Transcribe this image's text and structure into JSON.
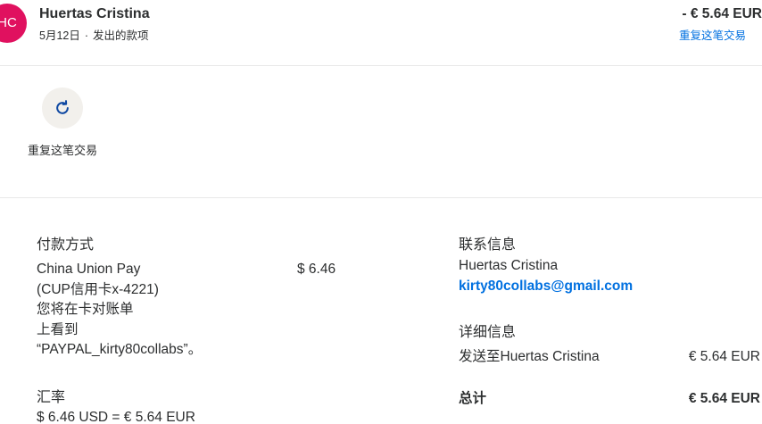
{
  "header": {
    "avatar_initials": "HC",
    "avatar_color": "#e0115f",
    "payee_name": "Huertas Cristina",
    "date": "5月12日",
    "separator": "·",
    "type": "发出的款项",
    "amount": "- € 5.64 EUR",
    "repeat_link": "重复这笔交易"
  },
  "actions": {
    "repeat_icon": "refresh-icon",
    "repeat_label": "重复这笔交易"
  },
  "payment": {
    "title": "付款方式",
    "method_line1": "China Union Pay",
    "method_line2": "(CUP信用卡x-4221)",
    "note_line1": "您将在卡对账单",
    "note_line2": "上看到",
    "note_line3": "“PAYPAL_kirty80collabs”。",
    "amount": "$ 6.46"
  },
  "exchange": {
    "title": "汇率",
    "rate": "$ 6.46 USD = € 5.64 EUR"
  },
  "contact": {
    "title": "联系信息",
    "name": "Huertas Cristina",
    "email": "kirty80collabs@gmail.com"
  },
  "details": {
    "title": "详细信息",
    "sent_to_label": "发送至Huertas Cristina",
    "sent_to_amount": "€ 5.64 EUR",
    "total_label": "总计",
    "total_amount": "€ 5.64 EUR"
  },
  "colors": {
    "link": "#0070e0",
    "text": "#2c2e2f",
    "divider": "#e8e8e8",
    "icon_bg": "#f2f0ec"
  }
}
